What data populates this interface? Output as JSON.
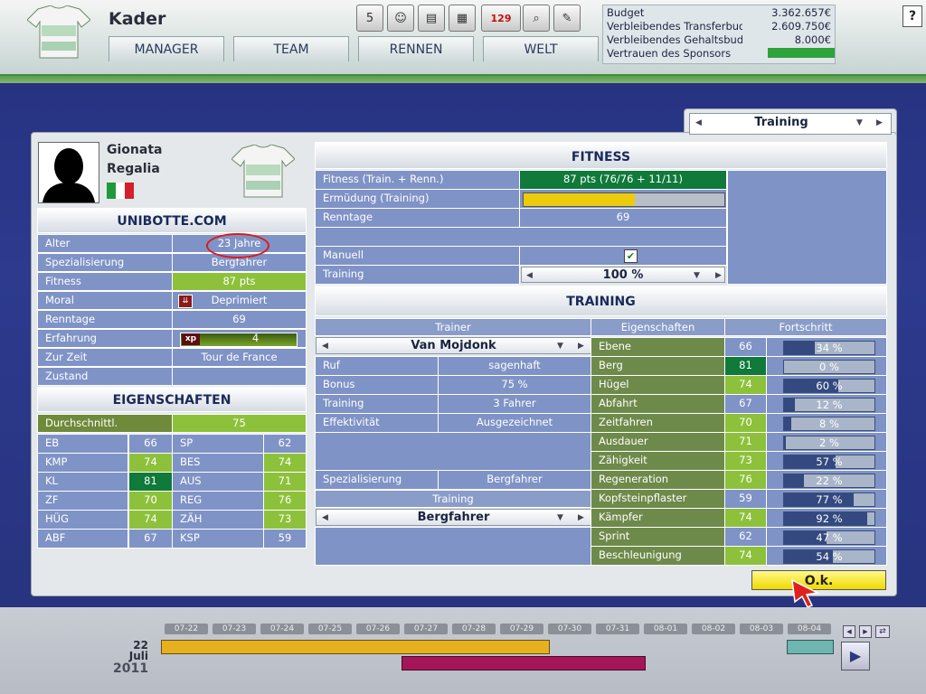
{
  "header": {
    "title": "Kader",
    "nav": [
      "MANAGER",
      "TEAM",
      "RENNEN",
      "WELT"
    ],
    "toolbar_icons": [
      "calendar-icon",
      "rider-icon",
      "money-icon",
      "news-icon",
      "mail-icon",
      "search-icon",
      "notes-icon"
    ],
    "mail_count": "129",
    "calendar_day": "5",
    "help": "?"
  },
  "budget": [
    {
      "label": "Budget",
      "value": "3.362.657€"
    },
    {
      "label": "Verbleibendes Transferbudg",
      "value": "2.609.750€"
    },
    {
      "label": "Verbleibendes Gehaltsbudg",
      "value": "8.000€"
    },
    {
      "label": "Vertrauen des Sponsors",
      "value": ""
    }
  ],
  "view_selector": "Training",
  "rider": {
    "first_name": "Gionata",
    "last_name": "Regalia",
    "team": "UNIBOTTE.COM",
    "rows": [
      {
        "label": "Alter",
        "value": "23 Jahre"
      },
      {
        "label": "Spezialisierung",
        "value": "Bergfahrer"
      },
      {
        "label": "Fitness",
        "value": "87 pts"
      },
      {
        "label": "Moral",
        "value": "Deprimiert"
      },
      {
        "label": "Renntage",
        "value": "69"
      },
      {
        "label": "Erfahrung",
        "value": "4"
      },
      {
        "label": "Zur Zeit",
        "value": "Tour de France"
      },
      {
        "label": "Zustand",
        "value": ""
      }
    ],
    "xp_badge": "xp"
  },
  "eigenschaften": {
    "title": "EIGENSCHAFTEN",
    "avg_label": "Durchschnittl.",
    "avg_value": "75",
    "rows": [
      {
        "a": "EB",
        "av": "66",
        "b": "SP",
        "bv": "62"
      },
      {
        "a": "KMP",
        "av": "74",
        "b": "BES",
        "bv": "74"
      },
      {
        "a": "KL",
        "av": "81",
        "b": "AUS",
        "bv": "71"
      },
      {
        "a": "ZF",
        "av": "70",
        "b": "REG",
        "bv": "76"
      },
      {
        "a": "HÜG",
        "av": "74",
        "b": "ZÄH",
        "bv": "73"
      },
      {
        "a": "ABF",
        "av": "67",
        "b": "KSP",
        "bv": "59"
      }
    ]
  },
  "fitness": {
    "title": "FITNESS",
    "rows": [
      {
        "label": "Fitness (Train. + Renn.)",
        "value": "87 pts (76/76 + 11/11)"
      },
      {
        "label": "Ermüdung (Training)",
        "value": ""
      },
      {
        "label": "Renntage",
        "value": "69"
      }
    ],
    "fatigue_level": 0.56,
    "manual_label": "Manuell",
    "training_label": "Training",
    "training_value": "100 %"
  },
  "training": {
    "title": "TRAINING",
    "trainer_header": "Trainer",
    "trainer": "Van Mojdonk",
    "rows": [
      {
        "label": "Ruf",
        "value": "sagenhaft"
      },
      {
        "label": "Bonus",
        "value": "75 %"
      },
      {
        "label": "Training",
        "value": "3 Fahrer"
      },
      {
        "label": "Effektivität",
        "value": "Ausgezeichnet"
      }
    ],
    "spec_label": "Spezialisierung",
    "spec_value": "Bergfahrer",
    "plan_header": "Training",
    "plan": "Bergfahrer",
    "attr_header": "Eigenschaften",
    "progress_header": "Fortschritt",
    "attributes": [
      {
        "name": "Ebene",
        "value": "66",
        "progress": "34 %",
        "p": 0.34
      },
      {
        "name": "Berg",
        "value": "81",
        "progress": "0 %",
        "p": 0.0
      },
      {
        "name": "Hügel",
        "value": "74",
        "progress": "60 %",
        "p": 0.6
      },
      {
        "name": "Abfahrt",
        "value": "67",
        "progress": "12 %",
        "p": 0.12
      },
      {
        "name": "Zeitfahren",
        "value": "70",
        "progress": "8 %",
        "p": 0.08
      },
      {
        "name": "Ausdauer",
        "value": "71",
        "progress": "2 %",
        "p": 0.02
      },
      {
        "name": "Zähigkeit",
        "value": "73",
        "progress": "57 %",
        "p": 0.57
      },
      {
        "name": "Regeneration",
        "value": "76",
        "progress": "22 %",
        "p": 0.22
      },
      {
        "name": "Kopfsteinpflaster",
        "value": "59",
        "progress": "77 %",
        "p": 0.77
      },
      {
        "name": "Kämpfer",
        "value": "74",
        "progress": "92 %",
        "p": 0.92
      },
      {
        "name": "Sprint",
        "value": "62",
        "progress": "47 %",
        "p": 0.47
      },
      {
        "name": "Beschleunigung",
        "value": "74",
        "progress": "54 %",
        "p": 0.54
      }
    ]
  },
  "ok_button": "O.k.",
  "timeline": {
    "days": [
      "07-22",
      "07-23",
      "07-24",
      "07-25",
      "07-26",
      "07-27",
      "07-28",
      "07-29",
      "07-30",
      "07-31",
      "08-01",
      "08-02",
      "08-03",
      "08-04"
    ],
    "date_day": "22",
    "date_month": "Juli",
    "date_year": "2011"
  }
}
